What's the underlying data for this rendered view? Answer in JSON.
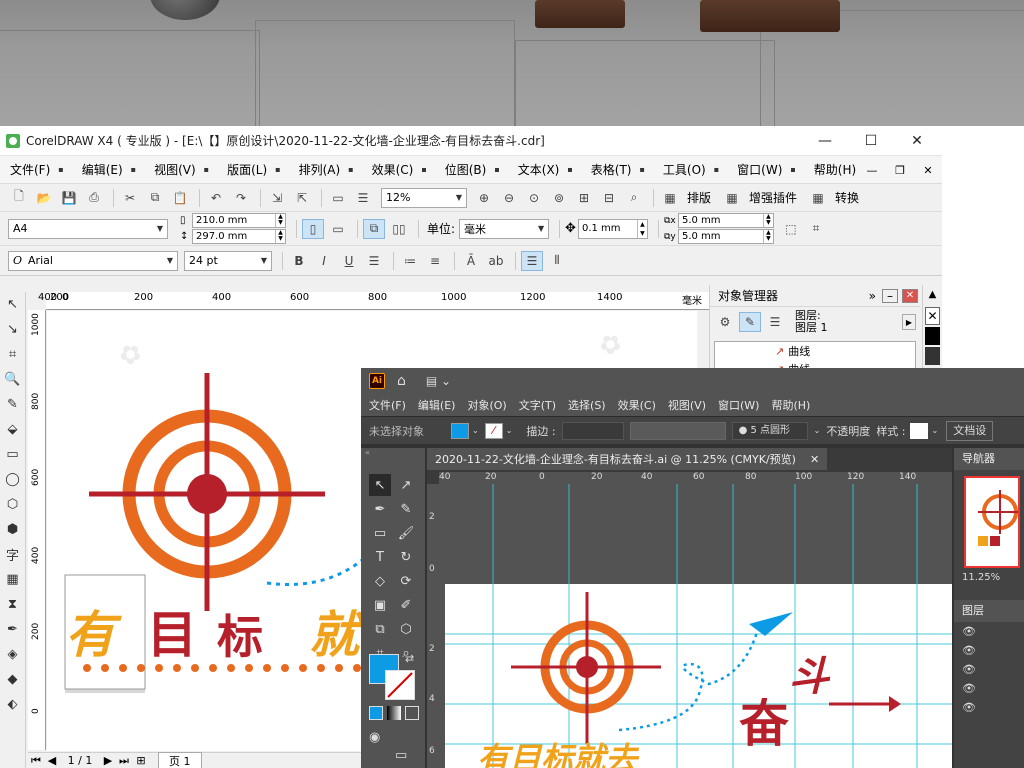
{
  "corel": {
    "title": "CorelDRAW X4 ( 专业版 ) - [E:\\【】原创设计\\2020-11-22-文化墙-企业理念-有目标去奋斗.cdr]",
    "menu": [
      "文件(F)",
      "编辑(E)",
      "视图(V)",
      "版面(L)",
      "排列(A)",
      "效果(C)",
      "位图(B)",
      "文本(X)",
      "表格(T)",
      "工具(O)",
      "窗口(W)",
      "帮助(H)"
    ],
    "zoom": "12%",
    "btn_layout": "排版",
    "btn_plugin": "增强插件",
    "btn_convert": "转换",
    "paper": "A4",
    "width": "210.0 mm",
    "height": "297.0 mm",
    "unit_label": "单位:",
    "unit_value": "毫米",
    "nudge": "0.1 mm",
    "dup_x": "5.0 mm",
    "dup_y": "5.0 mm",
    "font_name": "Arial",
    "font_size": "24 pt",
    "ruler_h": [
      "400",
      "200",
      "0",
      "200",
      "400",
      "600",
      "800",
      "1000",
      "1200",
      "1400",
      "毫米"
    ],
    "ruler_v": [
      "1000",
      "800",
      "600",
      "400",
      "200",
      "0"
    ],
    "page_nav": "1 / 1",
    "page_tab": "页 1",
    "docker": {
      "title": "对象管理器",
      "layer_line1": "图层:",
      "layer_line2": "图层 1",
      "items": [
        "曲线",
        "曲线"
      ]
    },
    "art": {
      "chars": [
        "有",
        "目",
        "标",
        "就"
      ]
    }
  },
  "ai": {
    "menu": [
      "文件(F)",
      "编辑(E)",
      "对象(O)",
      "文字(T)",
      "选择(S)",
      "效果(C)",
      "视图(V)",
      "窗口(W)",
      "帮助(H)"
    ],
    "ctrl_no_selection": "未选择对象",
    "ctrl_stroke": "描边 :",
    "ctrl_brush": "5 点圆形",
    "ctrl_opacity": "不透明度",
    "ctrl_style": "样式 :",
    "ctrl_doc_settings": "文档设",
    "tab_title": "2020-11-22-文化墙-企业理念-有目标去奋斗.ai @ 11.25% (CMYK/预览)",
    "ruler_h": [
      "40",
      "20",
      "0",
      "20",
      "40",
      "60",
      "80",
      "100",
      "120",
      "140"
    ],
    "ruler_v": [
      "2",
      "0",
      "2",
      "4",
      "6"
    ],
    "nav_title": "导航器",
    "nav_zoom": "11.25%",
    "layers_title": "图层",
    "art": {
      "line": "有目标就去",
      "fen": "奋",
      "dou": "斗"
    }
  },
  "colors": {
    "orange": "#e86a1e",
    "red": "#b5202a",
    "yellow": "#f0a21b",
    "ai_blue": "#0d9be6"
  }
}
